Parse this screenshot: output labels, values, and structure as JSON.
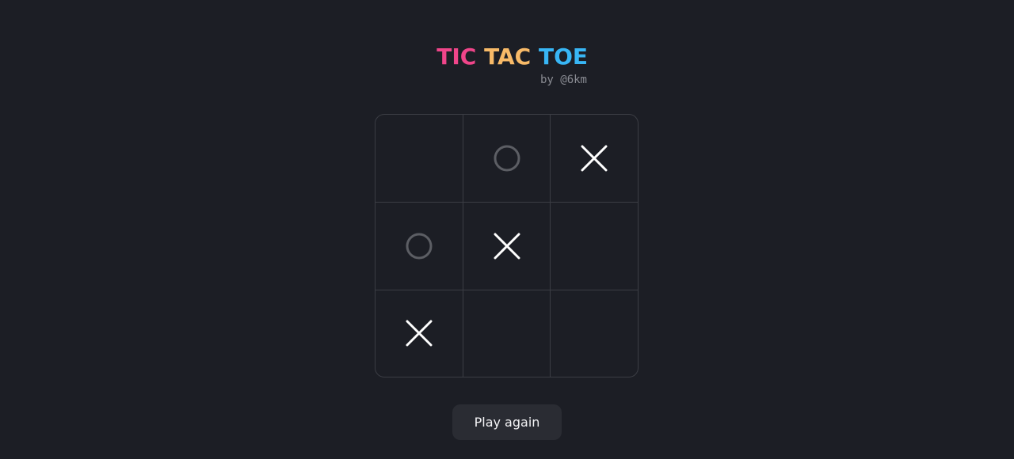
{
  "header": {
    "title_words": [
      "TIC",
      "TAC",
      "TOE"
    ],
    "byline": "by @6km"
  },
  "colors": {
    "background": "#1c1e25",
    "tic": "#f0458a",
    "tac": "#f8ba68",
    "toe": "#38b6f5",
    "x_mark": "#ffffff",
    "o_mark": "#5c5e64",
    "grid": "#3b3d44",
    "button_bg": "#2a2c33"
  },
  "board": {
    "cells": [
      "",
      "O",
      "X",
      "O",
      "X",
      "",
      "X",
      "",
      ""
    ]
  },
  "actions": {
    "play_again_label": "Play again"
  }
}
